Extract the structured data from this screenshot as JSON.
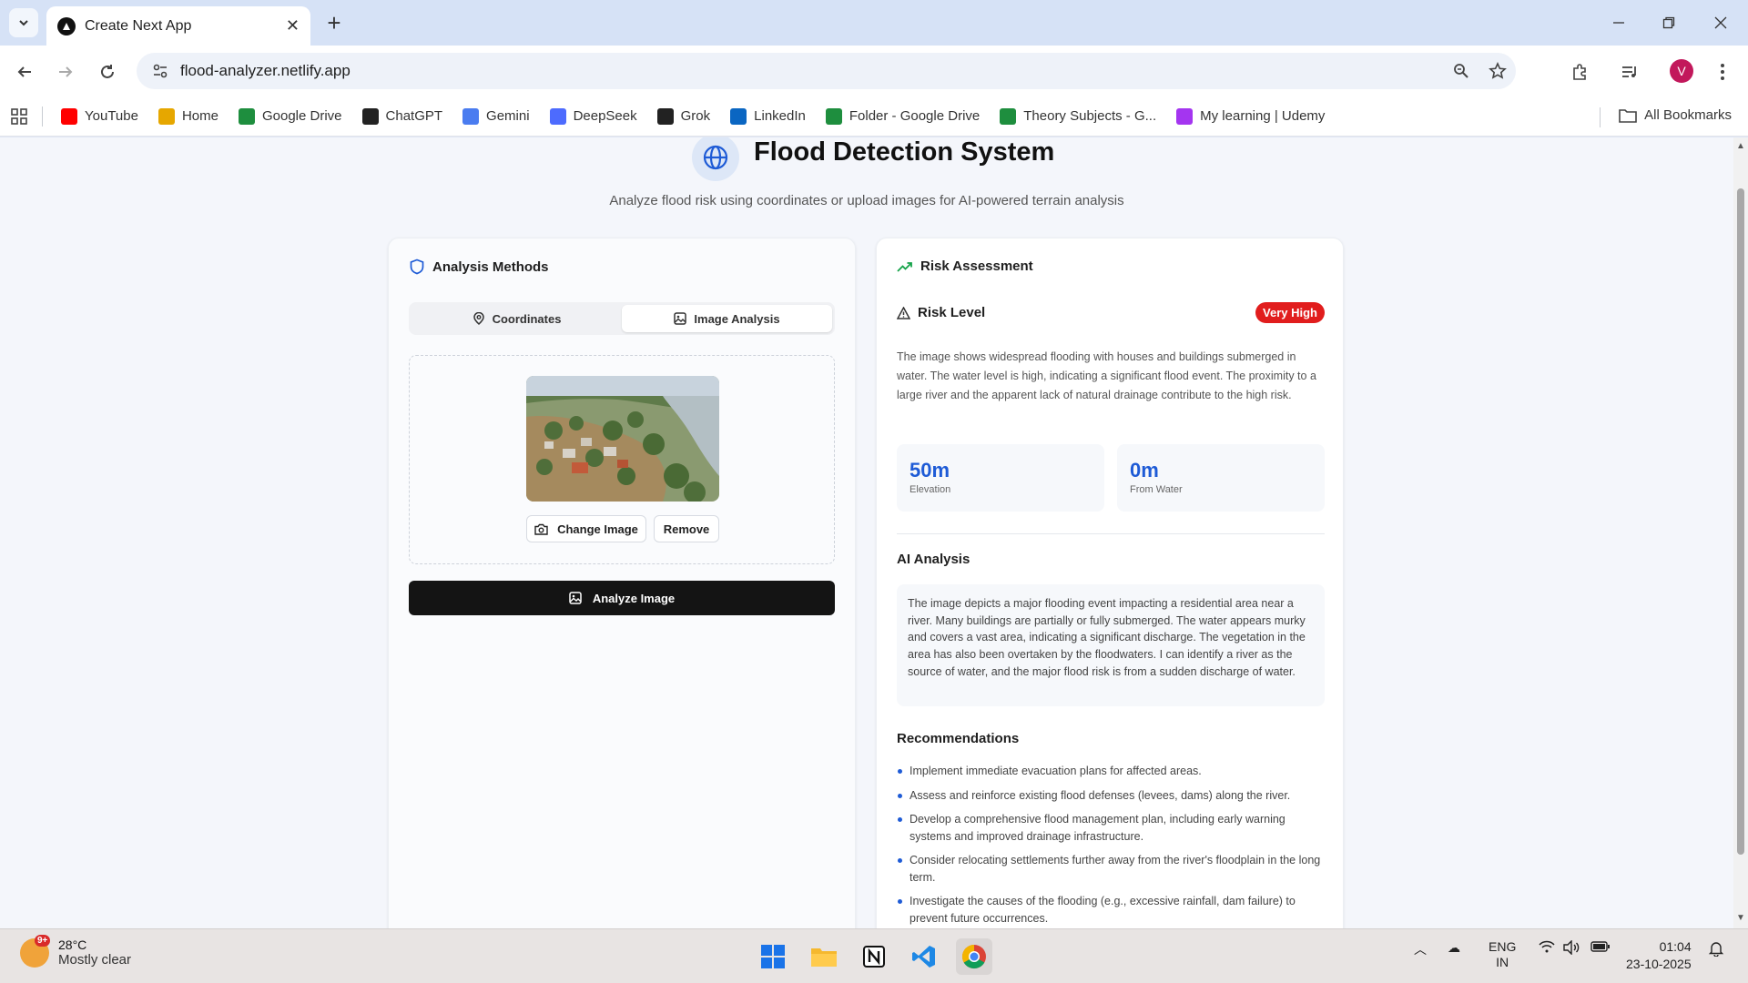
{
  "browser": {
    "tab_title": "Create Next App",
    "url": "flood-analyzer.netlify.app",
    "profile_initial": "V",
    "bookmarks": [
      {
        "label": "YouTube",
        "icon": "youtube-icon",
        "color": "#ff0000"
      },
      {
        "label": "Home",
        "icon": "home-icon",
        "color": "#e6a700"
      },
      {
        "label": "Google Drive",
        "icon": "google-drive-icon",
        "color": "#1e8e3e"
      },
      {
        "label": "ChatGPT",
        "icon": "chatgpt-icon",
        "color": "#222222"
      },
      {
        "label": "Gemini",
        "icon": "gemini-icon",
        "color": "#4a7cf0"
      },
      {
        "label": "DeepSeek",
        "icon": "deepseek-icon",
        "color": "#4d6bfe"
      },
      {
        "label": "Grok",
        "icon": "grok-icon",
        "color": "#222222"
      },
      {
        "label": "LinkedIn",
        "icon": "linkedin-icon",
        "color": "#0a66c2"
      },
      {
        "label": "Folder - Google Drive",
        "icon": "google-drive-icon",
        "color": "#1e8e3e"
      },
      {
        "label": "Theory Subjects - G...",
        "icon": "google-drive-icon",
        "color": "#1e8e3e"
      },
      {
        "label": "My learning | Udemy",
        "icon": "udemy-icon",
        "color": "#a435f0"
      }
    ],
    "all_bookmarks": "All Bookmarks"
  },
  "header": {
    "title": "Flood Detection System",
    "subtitle": "Analyze flood risk using coordinates or upload images for AI-powered terrain analysis"
  },
  "methods": {
    "title": "Analysis Methods",
    "tabs": [
      {
        "label": "Coordinates",
        "active": false
      },
      {
        "label": "Image Analysis",
        "active": true
      }
    ],
    "change_image": "Change Image",
    "remove": "Remove",
    "analyze": "Analyze Image"
  },
  "assessment": {
    "title": "Risk Assessment",
    "risk_label": "Risk Level",
    "risk_badge": "Very High",
    "badge_color": "#e11d1d",
    "risk_description": "The image shows widespread flooding with houses and buildings submerged in water. The water level is high, indicating a significant flood event. The proximity to a large river and the apparent lack of natural drainage contribute to the high risk.",
    "stats": [
      {
        "value": "50m",
        "label": "Elevation"
      },
      {
        "value": "0m",
        "label": "From Water"
      }
    ],
    "ai_title": "AI Analysis",
    "ai_text": "The image depicts a major flooding event impacting a residential area near a river. Many buildings are partially or fully submerged. The water appears murky and covers a vast area, indicating a significant discharge. The vegetation in the area has also been overtaken by the floodwaters. I can identify a river as the source of water, and the major flood risk is from a sudden discharge of water.",
    "rec_title": "Recommendations",
    "recommendations": [
      "Implement immediate evacuation plans for affected areas.",
      "Assess and reinforce existing flood defenses (levees, dams) along the river.",
      "Develop a comprehensive flood management plan, including early warning systems and improved drainage infrastructure.",
      "Consider relocating settlements further away from the river's floodplain in the long term.",
      "Investigate the causes of the flooding (e.g., excessive rainfall, dam failure) to prevent future occurrences."
    ]
  },
  "taskbar": {
    "weather_badge": "9+",
    "temperature": "28°C",
    "weather": "Mostly clear",
    "lang": "ENG",
    "region": "IN",
    "time": "01:04",
    "date": "23-10-2025"
  }
}
